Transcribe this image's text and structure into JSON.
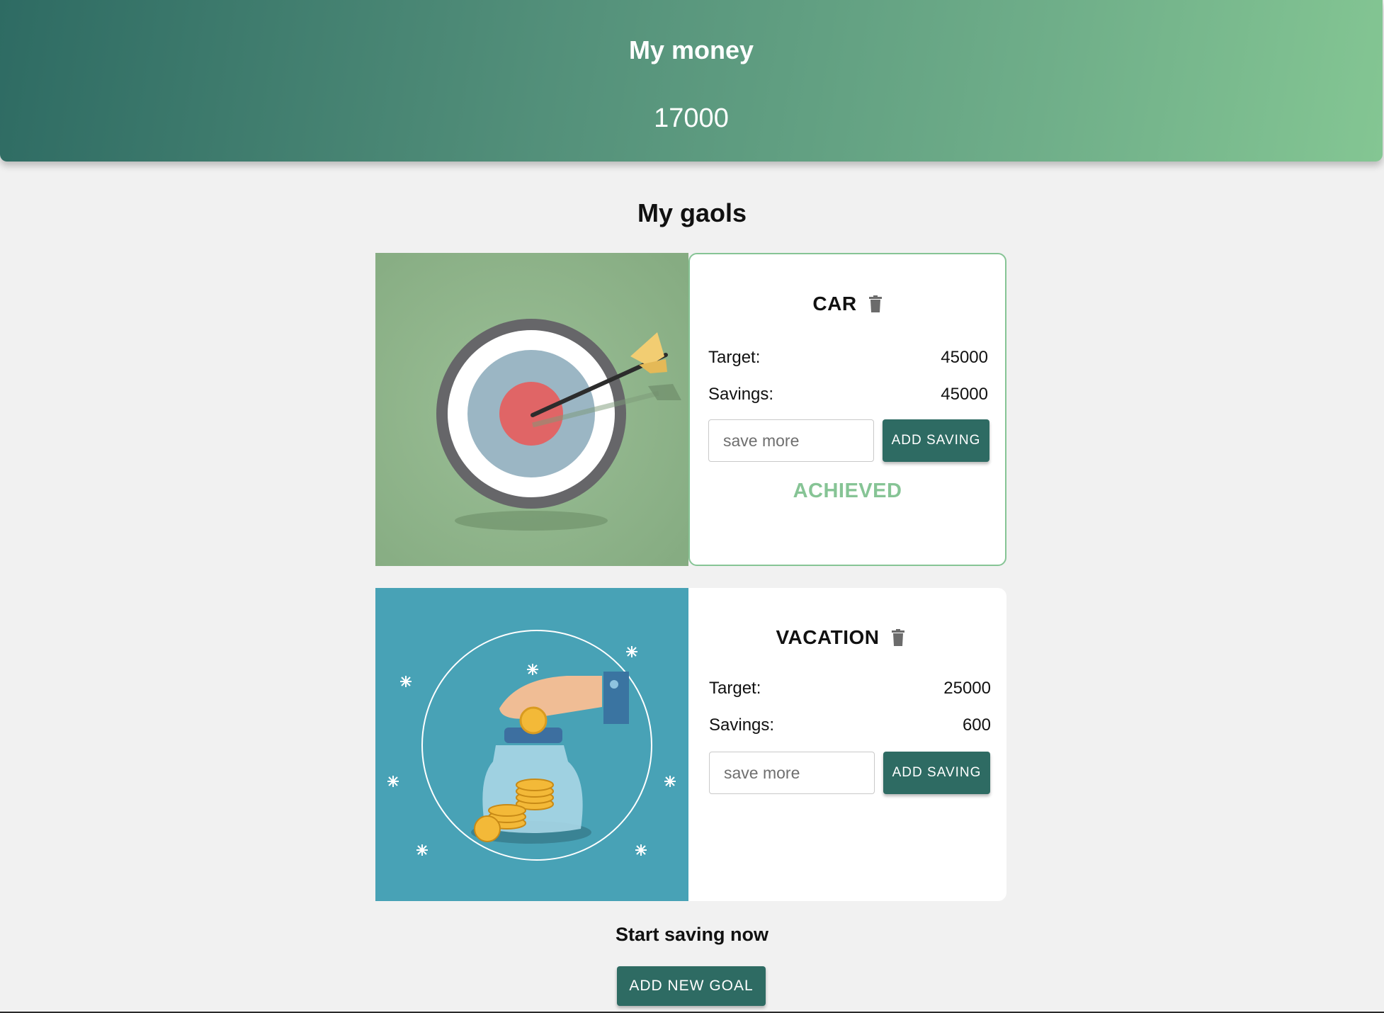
{
  "header": {
    "title": "My money",
    "amount": "17000"
  },
  "goals_title": "My gaols",
  "goals": [
    {
      "name": "CAR",
      "target_label": "Target:",
      "target_value": "45000",
      "savings_label": "Savings:",
      "savings_value": "45000",
      "input_placeholder": "save more",
      "button_label": "ADD SAVING",
      "status": "ACHIEVED",
      "image_icon": "target-arrow-illustration",
      "accent_color": "#86c495"
    },
    {
      "name": "VACATION",
      "target_label": "Target:",
      "target_value": "25000",
      "savings_label": "Savings:",
      "savings_value": "600",
      "input_placeholder": "save more",
      "button_label": "ADD SAVING",
      "image_icon": "coin-jar-illustration"
    }
  ],
  "footer": {
    "prompt": "Start saving now",
    "button_label": "ADD NEW GOAL"
  },
  "colors": {
    "primary": "#2e6b63",
    "achieved": "#86c495",
    "background": "#f1f1f1"
  }
}
